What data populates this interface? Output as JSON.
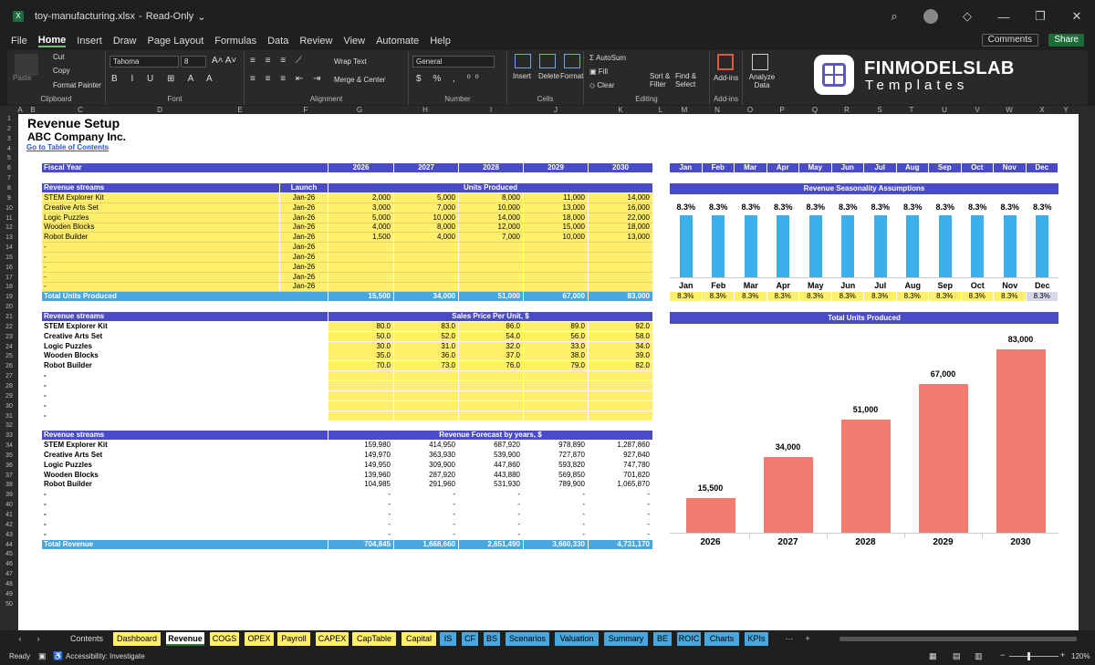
{
  "window": {
    "filename": "toy-manufacturing.xlsx",
    "mode": "Read-Only"
  },
  "menu": [
    "File",
    "Home",
    "Insert",
    "Draw",
    "Page Layout",
    "Formulas",
    "Data",
    "Review",
    "View",
    "Automate",
    "Help"
  ],
  "actions": {
    "comments": "Comments",
    "share": "Share"
  },
  "ribbon": {
    "clipboard": {
      "paste": "Paste",
      "cut": "Cut",
      "copy": "Copy",
      "format_painter": "Format Painter",
      "label": "Clipboard"
    },
    "font": {
      "name": "Tahoma",
      "size": "8",
      "label": "Font"
    },
    "alignment": {
      "wrap": "Wrap Text",
      "merge": "Merge & Center",
      "label": "Alignment"
    },
    "number": {
      "format": "General",
      "label": "Number"
    },
    "cells": {
      "insert": "Insert",
      "delete": "Delete",
      "format": "Format",
      "label": "Cells"
    },
    "editing": {
      "autosum": "AutoSum",
      "fill": "Fill",
      "clear": "Clear",
      "sort": "Sort & Filter",
      "find": "Find & Select",
      "label": "Editing"
    },
    "addins": {
      "addins": "Add-ins",
      "label": "Add-ins"
    },
    "analyze": {
      "label": "Analyze Data"
    }
  },
  "brand": {
    "line1": "FINMODELSLAB",
    "line2": "Templates"
  },
  "columns": [
    "A",
    "B",
    "C",
    "D",
    "E",
    "F",
    "G",
    "H",
    "I",
    "J",
    "K",
    "L",
    "M",
    "N",
    "O",
    "P",
    "Q",
    "R",
    "S",
    "T",
    "U",
    "V",
    "W",
    "X",
    "Y"
  ],
  "sheet": {
    "title": "Revenue Setup",
    "company": "ABC Company Inc.",
    "toc_link": "Go to Table of Contents",
    "fiscal_label": "Fiscal Year",
    "years": [
      "2026",
      "2027",
      "2028",
      "2029",
      "2030"
    ],
    "months": [
      "Jan",
      "Feb",
      "Mar",
      "Apr",
      "May",
      "Jun",
      "Jul",
      "Aug",
      "Sep",
      "Oct",
      "Nov",
      "Dec"
    ],
    "units": {
      "header": "Revenue streams",
      "launch_header": "Launch",
      "title": "Units Produced",
      "rows": [
        {
          "name": "STEM Explorer Kit",
          "launch": "Jan-26",
          "vals": [
            "2,000",
            "5,000",
            "8,000",
            "11,000",
            "14,000"
          ]
        },
        {
          "name": "Creative Arts Set",
          "launch": "Jan-26",
          "vals": [
            "3,000",
            "7,000",
            "10,000",
            "13,000",
            "16,000"
          ]
        },
        {
          "name": "Logic Puzzles",
          "launch": "Jan-26",
          "vals": [
            "5,000",
            "10,000",
            "14,000",
            "18,000",
            "22,000"
          ]
        },
        {
          "name": "Wooden Blocks",
          "launch": "Jan-26",
          "vals": [
            "4,000",
            "8,000",
            "12,000",
            "15,000",
            "18,000"
          ]
        },
        {
          "name": "Robot Builder",
          "launch": "Jan-26",
          "vals": [
            "1,500",
            "4,000",
            "7,000",
            "10,000",
            "13,000"
          ]
        },
        {
          "name": "-",
          "launch": "Jan-26",
          "vals": [
            "",
            "",
            "",
            "",
            ""
          ]
        },
        {
          "name": "-",
          "launch": "Jan-26",
          "vals": [
            "",
            "",
            "",
            "",
            ""
          ]
        },
        {
          "name": "-",
          "launch": "Jan-26",
          "vals": [
            "",
            "",
            "",
            "",
            ""
          ]
        },
        {
          "name": "-",
          "launch": "Jan-26",
          "vals": [
            "",
            "",
            "",
            "",
            ""
          ]
        },
        {
          "name": "-",
          "launch": "Jan-26",
          "vals": [
            "",
            "",
            "",
            "",
            ""
          ]
        }
      ],
      "total_label": "Total Units Produced",
      "totals": [
        "15,500",
        "34,000",
        "51,000",
        "67,000",
        "83,000"
      ]
    },
    "price": {
      "header": "Revenue streams",
      "title": "Sales Price Per Unit, $",
      "rows": [
        {
          "name": "STEM Explorer Kit",
          "vals": [
            "80.0",
            "83.0",
            "86.0",
            "89.0",
            "92.0"
          ]
        },
        {
          "name": "Creative Arts Set",
          "vals": [
            "50.0",
            "52.0",
            "54.0",
            "56.0",
            "58.0"
          ]
        },
        {
          "name": "Logic Puzzles",
          "vals": [
            "30.0",
            "31.0",
            "32.0",
            "33.0",
            "34.0"
          ]
        },
        {
          "name": "Wooden Blocks",
          "vals": [
            "35.0",
            "36.0",
            "37.0",
            "38.0",
            "39.0"
          ]
        },
        {
          "name": "Robot Builder",
          "vals": [
            "70.0",
            "73.0",
            "76.0",
            "79.0",
            "82.0"
          ]
        },
        {
          "name": "-",
          "vals": [
            "",
            "",
            "",
            "",
            ""
          ]
        },
        {
          "name": "-",
          "vals": [
            "",
            "",
            "",
            "",
            ""
          ]
        },
        {
          "name": "-",
          "vals": [
            "",
            "",
            "",
            "",
            ""
          ]
        },
        {
          "name": "-",
          "vals": [
            "",
            "",
            "",
            "",
            ""
          ]
        },
        {
          "name": "-",
          "vals": [
            "",
            "",
            "",
            "",
            ""
          ]
        }
      ]
    },
    "revenue": {
      "header": "Revenue streams",
      "title": "Revenue Forecast by years, $",
      "rows": [
        {
          "name": "STEM Explorer Kit",
          "vals": [
            "159,980",
            "414,950",
            "687,920",
            "978,890",
            "1,287,860"
          ]
        },
        {
          "name": "Creative Arts Set",
          "vals": [
            "149,970",
            "363,930",
            "539,900",
            "727,870",
            "927,840"
          ]
        },
        {
          "name": "Logic Puzzles",
          "vals": [
            "149,950",
            "309,900",
            "447,860",
            "593,820",
            "747,780"
          ]
        },
        {
          "name": "Wooden Blocks",
          "vals": [
            "139,960",
            "287,920",
            "443,880",
            "569,850",
            "701,820"
          ]
        },
        {
          "name": "Robot Builder",
          "vals": [
            "104,985",
            "291,960",
            "531,930",
            "789,900",
            "1,065,870"
          ]
        },
        {
          "name": "-",
          "vals": [
            "-",
            "-",
            "-",
            "-",
            "-"
          ]
        },
        {
          "name": "-",
          "vals": [
            "-",
            "-",
            "-",
            "-",
            "-"
          ]
        },
        {
          "name": "-",
          "vals": [
            "-",
            "-",
            "-",
            "-",
            "-"
          ]
        },
        {
          "name": "-",
          "vals": [
            "-",
            "-",
            "-",
            "-",
            "-"
          ]
        },
        {
          "name": "-",
          "vals": [
            "-",
            "-",
            "-",
            "-",
            "-"
          ]
        }
      ],
      "total_label": "Total Revenue",
      "totals": [
        "704,845",
        "1,668,660",
        "2,651,490",
        "3,660,330",
        "4,731,170"
      ]
    },
    "seasonality": {
      "title": "Revenue Seasonality Assumptions",
      "values": [
        "8.3%",
        "8.3%",
        "8.3%",
        "8.3%",
        "8.3%",
        "8.3%",
        "8.3%",
        "8.3%",
        "8.3%",
        "8.3%",
        "8.3%",
        "8.3%"
      ]
    },
    "units_chart_title": "Total Units Produced"
  },
  "chart_data": [
    {
      "type": "bar",
      "title": "Revenue Seasonality Assumptions",
      "categories": [
        "Jan",
        "Feb",
        "Mar",
        "Apr",
        "May",
        "Jun",
        "Jul",
        "Aug",
        "Sep",
        "Oct",
        "Nov",
        "Dec"
      ],
      "values": [
        8.3,
        8.3,
        8.3,
        8.3,
        8.3,
        8.3,
        8.3,
        8.3,
        8.3,
        8.3,
        8.3,
        8.3
      ],
      "color": "#3bb0ea"
    },
    {
      "type": "bar",
      "title": "Total Units Produced",
      "categories": [
        "2026",
        "2027",
        "2028",
        "2029",
        "2030"
      ],
      "values": [
        15500,
        34000,
        51000,
        67000,
        83000
      ],
      "labels": [
        "15,500",
        "34,000",
        "51,000",
        "67,000",
        "83,000"
      ],
      "ylim": [
        0,
        90000
      ],
      "color": "#f07b6e"
    }
  ],
  "tabs": [
    {
      "label": "Contents",
      "color": "#1f1f1f",
      "text": "#ddd"
    },
    {
      "label": "Dashboard",
      "color": "#ffef6a"
    },
    {
      "label": "Revenue",
      "color": "#ffffff",
      "active": true
    },
    {
      "label": "COGS",
      "color": "#ffef6a"
    },
    {
      "label": "OPEX",
      "color": "#ffef6a"
    },
    {
      "label": "Payroll",
      "color": "#ffef6a"
    },
    {
      "label": "CAPEX",
      "color": "#ffef6a"
    },
    {
      "label": "CapTable",
      "color": "#ffef6a"
    },
    {
      "label": "Capital",
      "color": "#ffef6a"
    },
    {
      "label": "IS",
      "color": "#47a8df"
    },
    {
      "label": "CF",
      "color": "#47a8df"
    },
    {
      "label": "BS",
      "color": "#47a8df"
    },
    {
      "label": "Scenarios",
      "color": "#47a8df"
    },
    {
      "label": "Valuation",
      "color": "#47a8df"
    },
    {
      "label": "Summary",
      "color": "#47a8df"
    },
    {
      "label": "BE",
      "color": "#47a8df"
    },
    {
      "label": "ROIC",
      "color": "#47a8df"
    },
    {
      "label": "Charts",
      "color": "#47a8df"
    },
    {
      "label": "KPIs",
      "color": "#47a8df"
    }
  ],
  "status": {
    "ready": "Ready",
    "accessibility": "Accessibility: Investigate",
    "zoom": "120%"
  }
}
